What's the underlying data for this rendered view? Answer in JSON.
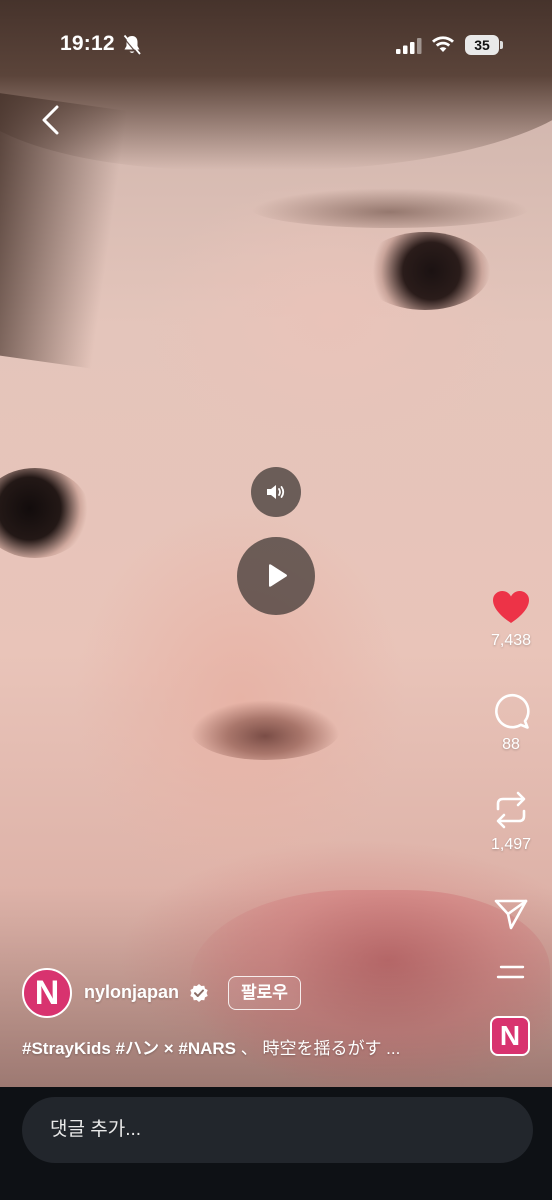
{
  "status_bar": {
    "time": "19:12",
    "battery": "35"
  },
  "player": {
    "mute_icon": "speaker-icon",
    "play_icon": "play-icon"
  },
  "actions": {
    "likes": "7,438",
    "comments": "88",
    "reposts": "1,497",
    "like_color": "#ed3347"
  },
  "post": {
    "avatar_letter": "N",
    "username": "nylonjapan",
    "follow_label": "팔로우",
    "caption_tags": "#StrayKids #ハン × #NARS",
    "caption_text": " 、 時空を揺るがす ..."
  },
  "comment": {
    "placeholder": "댓글 추가..."
  },
  "brand": {
    "accent": "#d8336f"
  }
}
